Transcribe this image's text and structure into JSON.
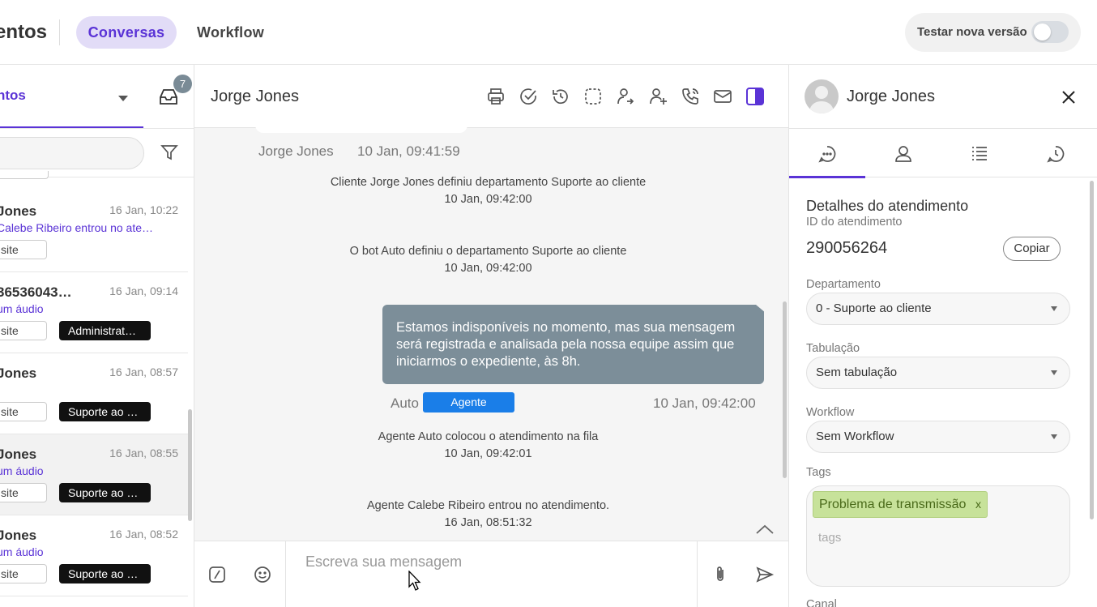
{
  "header": {
    "app_title": "entos",
    "tabs": [
      {
        "label": "Conversas",
        "active": true
      },
      {
        "label": "Workflow",
        "active": false
      }
    ],
    "test_version_label": "Testar nova versão",
    "test_version_enabled": false
  },
  "sidebar": {
    "tab_label": "ntos",
    "inbox_badge": "7",
    "conversations": [
      {
        "name": "Jones",
        "time": "16 Jan, 10:22",
        "message": "Calebe Ribeiro entrou no ate…",
        "channel": "site",
        "department": ""
      },
      {
        "name": "36536043…",
        "time": "16 Jan, 09:14",
        "message": "um áudio",
        "channel": "site",
        "department": "Administrat…"
      },
      {
        "name": "Jones",
        "time": "16 Jan, 08:57",
        "message": "",
        "channel": "site",
        "department": "Suporte ao …"
      },
      {
        "name": "Jones",
        "time": "16 Jan, 08:55",
        "message": "um áudio",
        "channel": "site",
        "department": "Suporte ao …",
        "active": true
      },
      {
        "name": "Jones",
        "time": "16 Jan, 08:52",
        "message": "um áudio",
        "channel": "site",
        "department": "Suporte ao …"
      }
    ]
  },
  "chat": {
    "title": "Jorge Jones",
    "header_icons": [
      "print-icon",
      "check-circle-icon",
      "history-icon",
      "dashed-square-icon",
      "transfer-user-icon",
      "add-user-icon",
      "phone-icon",
      "mail-icon",
      "panel-toggle-icon"
    ],
    "prev_sender": "Jorge Jones",
    "prev_time": "10 Jan, 09:41:59",
    "system_messages": [
      {
        "text": "Cliente Jorge Jones definiu departamento Suporte ao cliente",
        "time": "10 Jan, 09:42:00"
      },
      {
        "text": "O bot Auto definiu o departamento Suporte ao cliente",
        "time": "10 Jan, 09:42:00"
      },
      {
        "text": "Agente Auto colocou o atendimento na fila",
        "time": "10 Jan, 09:42:01"
      },
      {
        "text": "Agente Calebe Ribeiro entrou no atendimento.",
        "time": "16 Jan, 08:51:32"
      }
    ],
    "agent_message": {
      "text": "Estamos indisponíveis no momento, mas sua mensagem será registrada e analisada pela nossa equipe assim que iniciarmos o expediente, às 8h.",
      "sender": "Auto",
      "role_badge": "Agente",
      "time": "10 Jan, 09:42:00"
    },
    "composer_placeholder": "Escreva sua mensagem"
  },
  "details": {
    "contact_name": "Jorge Jones",
    "tabs": [
      "chat-bubble-icon",
      "user-icon",
      "list-icon",
      "history-chat-icon"
    ],
    "section_title": "Detalhes do atendimento",
    "id_label": "ID do atendimento",
    "id_value": "290056264",
    "copy_label": "Copiar",
    "department_label": "Departamento",
    "department_value": "0 - Suporte ao cliente",
    "tabulation_label": "Tabulação",
    "tabulation_value": "Sem tabulação",
    "workflow_label": "Workflow",
    "workflow_value": "Sem Workflow",
    "tags_label": "Tags",
    "tags": [
      "Problema de transmissão"
    ],
    "tag_remove": "x",
    "tags_placeholder": "tags",
    "canal_label": "Canal"
  },
  "colors": {
    "accent": "#5a33d6",
    "agent_bubble": "#7c8e99",
    "agent_badge": "#1a7ee8",
    "tag": "#c7e29a"
  }
}
